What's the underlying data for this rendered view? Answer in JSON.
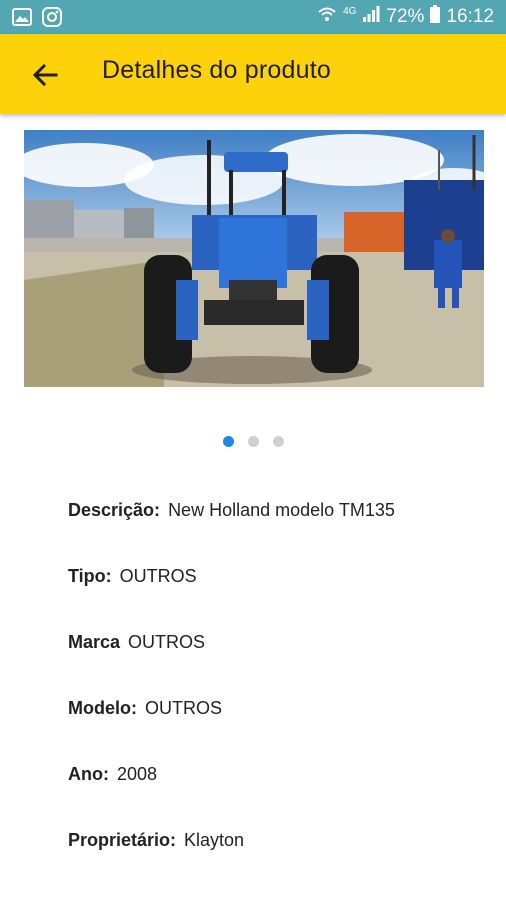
{
  "status_bar": {
    "signal_label": "4G",
    "battery": "72%",
    "time": "16:12"
  },
  "app_bar": {
    "title": "Detalhes do produto"
  },
  "carousel": {
    "image_description": "Trator azul New Holland",
    "pages": 3,
    "active_page": 1
  },
  "details": [
    {
      "label": "Descrição:",
      "value": "New Holland modelo TM135"
    },
    {
      "label": "Tipo:",
      "value": "OUTROS"
    },
    {
      "label": "Marca",
      "value": "OUTROS"
    },
    {
      "label": "Modelo:",
      "value": "OUTROS"
    },
    {
      "label": "Ano:",
      "value": "2008"
    },
    {
      "label": "Proprietário:",
      "value": "Klayton"
    }
  ],
  "colors": {
    "status_bar": "#53a7b3",
    "app_bar": "#fdd20b",
    "dot_active": "#1e88e5",
    "dot_inactive": "#cfcfcf"
  }
}
